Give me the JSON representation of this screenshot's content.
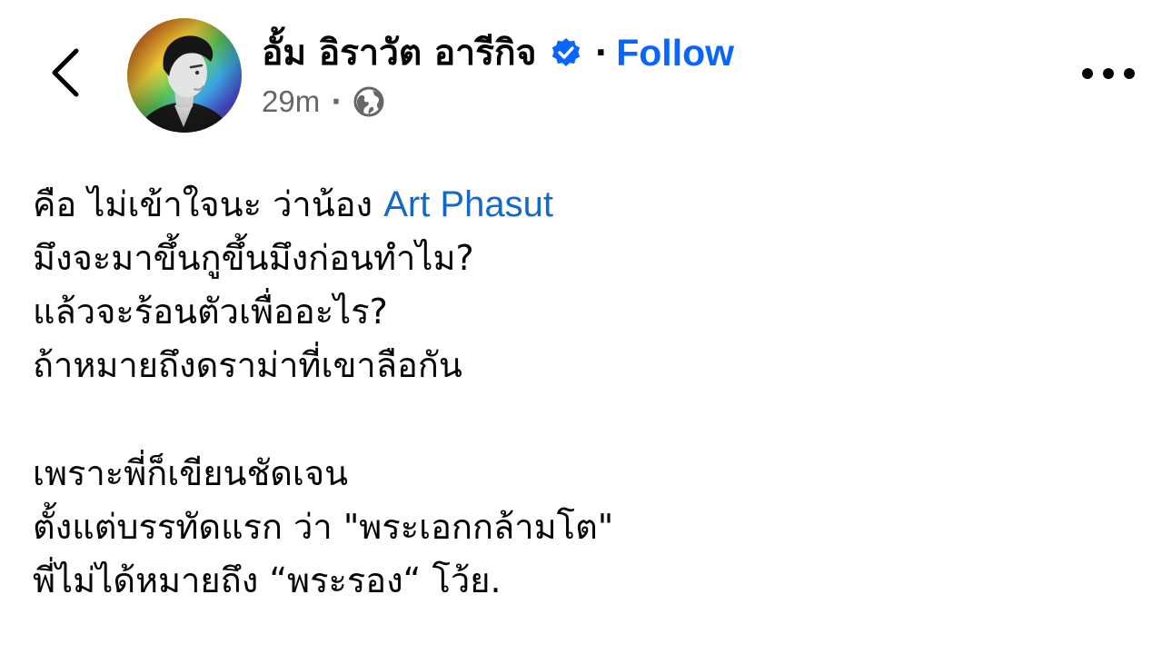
{
  "header": {
    "author_name": "อั้ม อิราวัต อารีกิจ",
    "separator": "·",
    "follow_label": "Follow",
    "timestamp": "29m",
    "meta_separator": "·",
    "visibility_icon": "globe-icon",
    "back_icon": "chevron-left-icon",
    "more_icon": "more-horizontal-icon",
    "verified_icon": "verified-badge-icon"
  },
  "post": {
    "line1_text": "คือ ไม่เข้าใจนะ ว่าน้อง ",
    "mention": "Art Phasut",
    "lines": [
      "มึงจะมาขึ้นกูขึ้นมึงก่อนทำไม?",
      "แล้วจะร้อนตัวเพื่ออะไร?",
      "ถ้าหมายถึงดราม่าที่เขาลือกัน",
      "",
      "เพราะพี่ก็เขียนชัดเจน",
      "ตั้งแต่บรรทัดแรก ว่า \"พระเอกกล้ามโต\"",
      "พี่ไม่ได้หมายถึง “พระรอง“ โว้ย."
    ]
  },
  "colors": {
    "link": "#0866ff",
    "mention": "#1468c8",
    "verified": "#0866ff",
    "secondary_text": "#65676b",
    "text": "#050505"
  }
}
